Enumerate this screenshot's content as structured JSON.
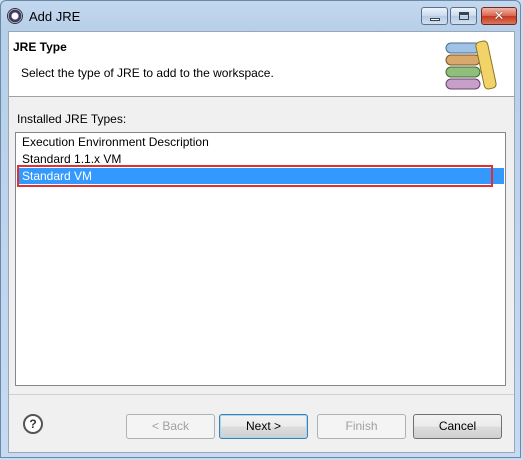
{
  "window": {
    "title": "Add JRE"
  },
  "header": {
    "title": "JRE Type",
    "description": "Select the type of JRE to add to the workspace.",
    "graphic_icon": "jre-books-icon"
  },
  "list": {
    "label": "Installed JRE Types:",
    "items": [
      "Execution Environment Description",
      "Standard 1.1.x VM",
      "Standard VM"
    ],
    "selected": "Standard VM"
  },
  "buttons": {
    "help": "?",
    "back": "< Back",
    "next": "Next >",
    "finish": "Finish",
    "cancel": "Cancel"
  },
  "colors": {
    "selection": "#3399ff",
    "highlight_border": "#e03030"
  }
}
